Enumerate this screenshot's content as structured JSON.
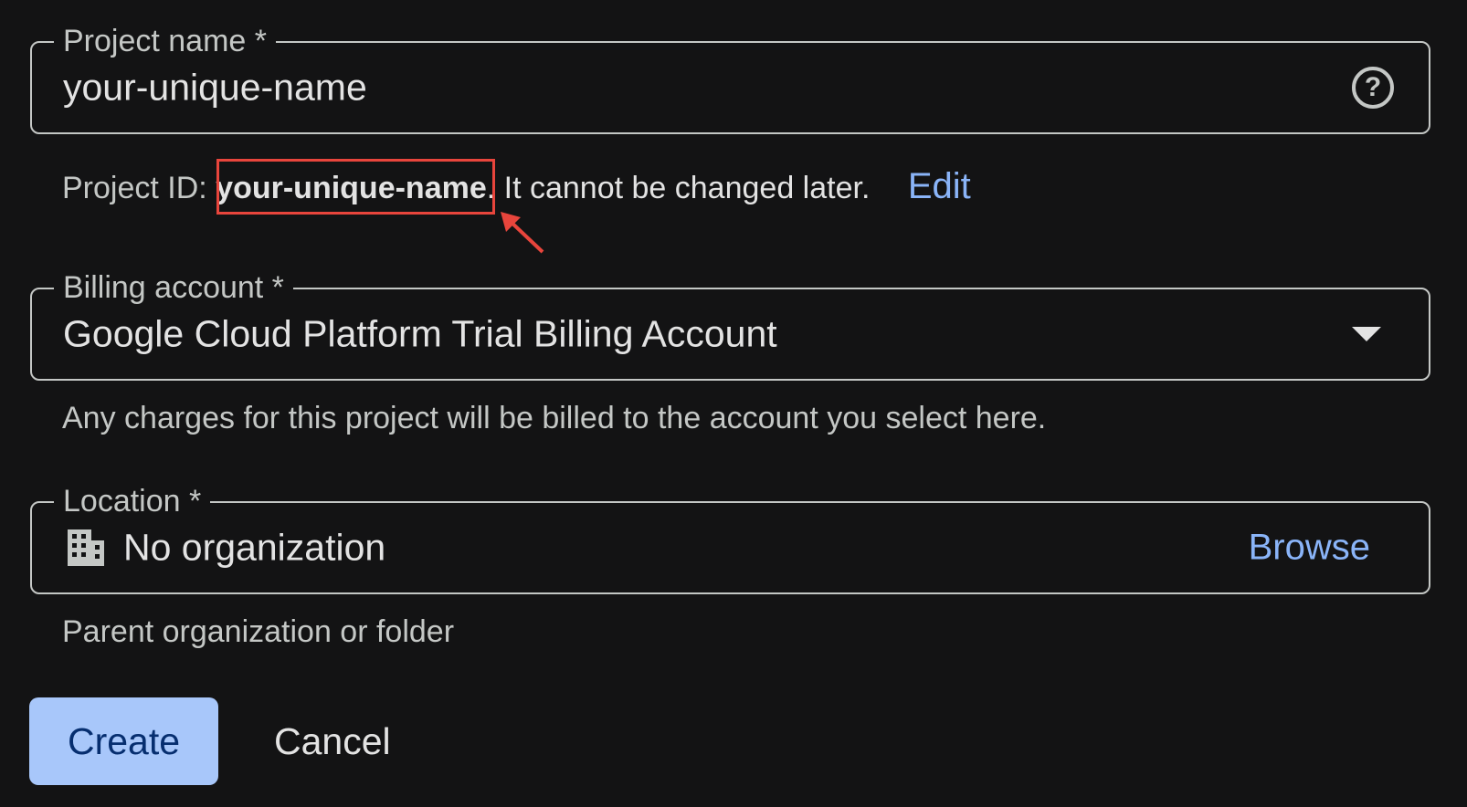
{
  "project_name": {
    "label": "Project name *",
    "value": "your-unique-name"
  },
  "project_id": {
    "prefix": "Project ID: ",
    "value": "your-unique-name",
    "suffix": ". It cannot be changed later.",
    "edit_label": "Edit"
  },
  "billing": {
    "label": "Billing account *",
    "value": "Google Cloud Platform Trial Billing Account",
    "hint": "Any charges for this project will be billed to the account you select here."
  },
  "location": {
    "label": "Location *",
    "value": "No organization",
    "browse_label": "Browse",
    "hint": "Parent organization or folder"
  },
  "actions": {
    "create_label": "Create",
    "cancel_label": "Cancel"
  },
  "icons": {
    "help": "help-circle-icon",
    "dropdown": "chevron-down-icon",
    "building": "building-icon"
  },
  "colors": {
    "background": "#131314",
    "accent": "#8ab4f8",
    "primary_button": "#a8c7fa",
    "annotation": "#e8453c"
  }
}
